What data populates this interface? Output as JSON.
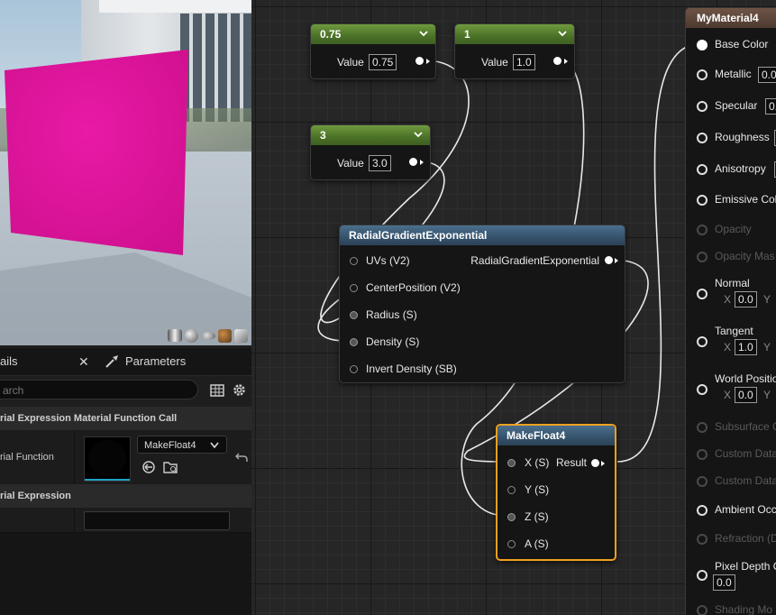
{
  "viewport": {
    "preview_buttons": [
      "cylinder-preview-icon",
      "sphere-preview-icon",
      "plane-preview-icon",
      "cube-preview-icon",
      "custom-mesh-preview-icon"
    ]
  },
  "details": {
    "tab_label": "ails",
    "parameters_label": "Parameters",
    "search_placeholder": "arch",
    "section1": "rial Expression Material Function Call",
    "function_label": "rial Function",
    "function_value": "MakeFloat4",
    "section2": "rial Expression"
  },
  "nodes": {
    "c1": {
      "title": "0.75",
      "label": "Value",
      "value": "0.75"
    },
    "c2": {
      "title": "1",
      "label": "Value",
      "value": "1.0"
    },
    "c3": {
      "title": "3",
      "label": "Value",
      "value": "3.0"
    },
    "radial": {
      "title": "RadialGradientExponential",
      "inputs": [
        "UVs (V2)",
        "CenterPosition (V2)",
        "Radius (S)",
        "Density (S)",
        "Invert Density (SB)"
      ],
      "output": "RadialGradientExponential"
    },
    "make": {
      "title": "MakeFloat4",
      "inputs": [
        "X (S)",
        "Y (S)",
        "Z (S)",
        "A (S)"
      ],
      "output": "Result"
    }
  },
  "material": {
    "title": "MyMaterial4",
    "pins": {
      "base_color": "Base Color",
      "metallic": "Metallic",
      "metallic_val": "0.0",
      "specular": "Specular",
      "specular_val": "0.",
      "roughness": "Roughness",
      "anisotropy": "Anisotropy",
      "emissive": "Emissive Col",
      "opacity": "Opacity",
      "opacity_mask": "Opacity Mas",
      "normal": "Normal",
      "normal_x": "0.0",
      "tangent": "Tangent",
      "tangent_x": "1.0",
      "world_pos": "World Positio",
      "world_x": "0.0",
      "subsurface": "Subsurface C",
      "custom1": "Custom Data",
      "custom2": "Custom Data",
      "ambient": "Ambient Occ",
      "refraction": "Refraction (D",
      "pixel_depth": "Pixel Depth O",
      "pixel_val": "0.0",
      "shading": "Shading Mo",
      "x": "X",
      "y": "Y"
    }
  },
  "colors": {
    "preview_magenta": "#e0129e",
    "constant_header": "#5a8432",
    "function_header": "#3e5f7c",
    "selection_outline": "#f0a020"
  }
}
